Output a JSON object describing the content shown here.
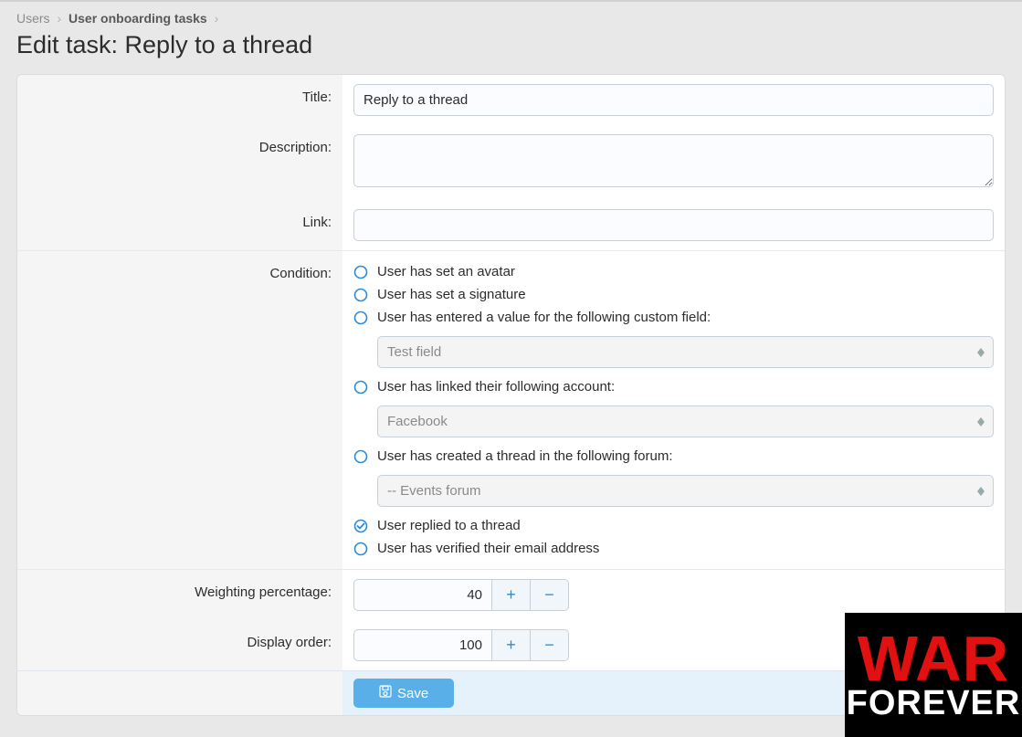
{
  "breadcrumb": {
    "item0": "Users",
    "item1": "User onboarding tasks"
  },
  "page_title": "Edit task: Reply to a thread",
  "labels": {
    "title": "Title:",
    "description": "Description:",
    "link": "Link:",
    "condition": "Condition:",
    "weighting": "Weighting percentage:",
    "display_order": "Display order:"
  },
  "fields": {
    "title_value": "Reply to a thread",
    "description_value": "",
    "link_value": "",
    "weighting_value": "40",
    "display_order_value": "100"
  },
  "conditions": {
    "c0": "User has set an avatar",
    "c1": "User has set a signature",
    "c2": "User has entered a value for the following custom field:",
    "c2_select": "Test field",
    "c3": "User has linked their following account:",
    "c3_select": "Facebook",
    "c4": "User has created a thread in the following forum:",
    "c4_select": "-- Events forum",
    "c5": "User replied to a thread",
    "c6": "User has verified their email address"
  },
  "footer": {
    "save": "Save"
  },
  "overlay": {
    "line1": "WAR",
    "line2": "FOREVER"
  }
}
